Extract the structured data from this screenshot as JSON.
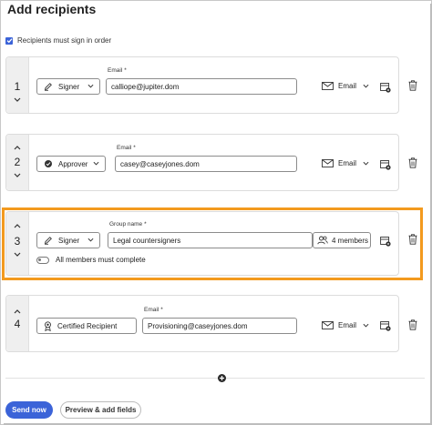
{
  "page": {
    "title": "Add recipients",
    "sign_in_order_label": "Recipients must sign in order",
    "sign_in_order_checked": true
  },
  "recipients": [
    {
      "number": "1",
      "role": "Signer",
      "role_icon": "pen-icon",
      "field_label": "Email",
      "required": "*",
      "value": "calliope@jupiter.dom",
      "delivery": "Email"
    },
    {
      "number": "2",
      "role": "Approver",
      "role_icon": "check-circle-icon",
      "field_label": "Email",
      "required": "*",
      "value": "casey@caseyjones.dom",
      "delivery": "Email"
    },
    {
      "number": "3",
      "role": "Signer",
      "role_icon": "pen-icon",
      "field_label": "Group name",
      "required": "*",
      "value": "Legal countersigners",
      "members": "4 members",
      "toggle_label": "All members must complete",
      "toggle_on": false
    },
    {
      "number": "4",
      "role": "Certified Recipient",
      "role_icon": "ribbon-icon",
      "field_label": "Email",
      "required": "*",
      "value": "Provisioning@caseyjones.dom",
      "delivery": "Email"
    }
  ],
  "footer": {
    "send_label": "Send now",
    "preview_label": "Preview & add fields"
  },
  "colors": {
    "accent": "#3b63d8",
    "highlight": "#f39a1e"
  }
}
